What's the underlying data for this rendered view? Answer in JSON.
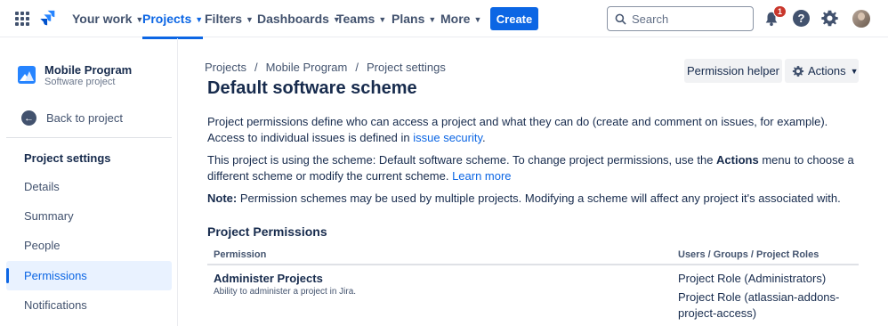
{
  "topnav": {
    "items": [
      {
        "label": "Your work",
        "active": false
      },
      {
        "label": "Projects",
        "active": true
      },
      {
        "label": "Filters",
        "active": false
      },
      {
        "label": "Dashboards",
        "active": false
      },
      {
        "label": "Teams",
        "active": false
      },
      {
        "label": "Plans",
        "active": false
      },
      {
        "label": "More",
        "active": false
      }
    ],
    "create_label": "Create",
    "search_placeholder": "Search",
    "notification_count": "1",
    "help_glyph": "?"
  },
  "sidebar": {
    "project_name": "Mobile Program",
    "project_type": "Software project",
    "back_label": "Back to project",
    "section_title": "Project settings",
    "items": [
      {
        "label": "Details",
        "active": false
      },
      {
        "label": "Summary",
        "active": false
      },
      {
        "label": "People",
        "active": false
      },
      {
        "label": "Permissions",
        "active": true
      },
      {
        "label": "Notifications",
        "active": false
      }
    ]
  },
  "main": {
    "breadcrumbs": [
      "Projects",
      "/",
      "Mobile Program",
      "/",
      "Project settings"
    ],
    "title": "Default software scheme",
    "permission_helper_label": "Permission helper",
    "actions_label": "Actions",
    "para1_before": "Project permissions define who can access a project and what they can do (create and comment on issues, for example). Access to individual issues is defined in ",
    "para1_link": "issue security",
    "para1_after": ".",
    "para2_before": "This project is using the scheme: Default software scheme. To change project permissions, use the ",
    "para2_bold": "Actions",
    "para2_middle": " menu to choose a different scheme or modify the current scheme. ",
    "para2_link": "Learn more",
    "note_label": "Note:",
    "note_text": " Permission schemes may be used by multiple projects. Modifying a scheme will affect any project it's associated with.",
    "section_title": "Project Permissions",
    "table": {
      "col_permission": "Permission",
      "col_users": "Users / Groups / Project Roles",
      "rows": [
        {
          "name": "Administer Projects",
          "description": "Ability to administer a project in Jira.",
          "roles": [
            "Project Role (Administrators)",
            "Project Role (atlassian-addons-project-access)"
          ]
        }
      ]
    }
  },
  "colors": {
    "accent": "#0c66e4",
    "text": "#172b4d",
    "subtle": "#42526e",
    "badge": "#c9372c"
  }
}
